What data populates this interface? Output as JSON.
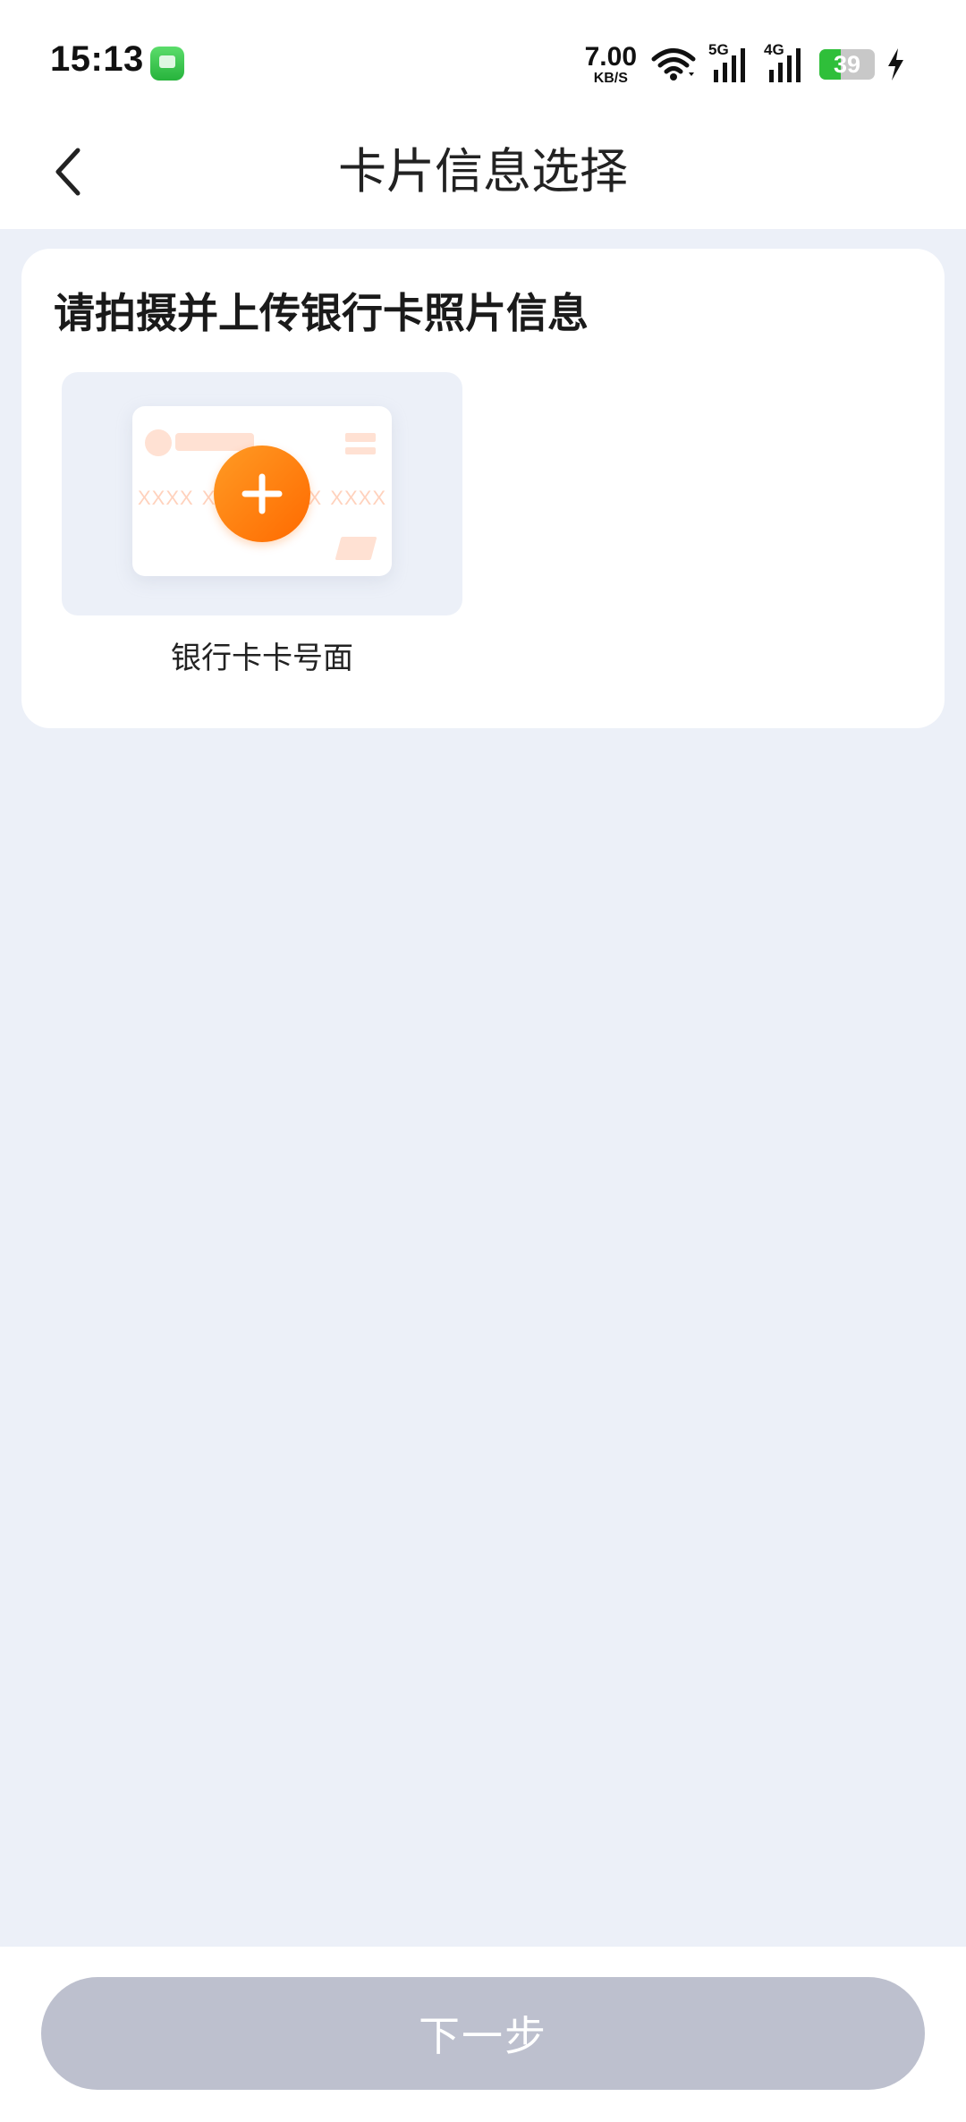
{
  "status_bar": {
    "time": "15:13",
    "net_speed_value": "7.00",
    "net_speed_unit": "KB/S",
    "signal_1_gen": "5G",
    "signal_2_gen": "4G",
    "battery_level": "39",
    "app_icon": "messages-icon"
  },
  "header": {
    "back_icon": "chevron-left-icon",
    "title": "卡片信息选择"
  },
  "upload_card": {
    "title": "请拍摄并上传银行卡照片信息",
    "item": {
      "label": "银行卡卡号面",
      "card_digits": [
        "XXXX",
        "XXXX",
        "XXXX",
        "XXXX"
      ],
      "add_icon": "plus-icon"
    }
  },
  "footer": {
    "next_label": "下一步",
    "next_enabled": false
  },
  "colors": {
    "page_bg": "#ecf0f8",
    "accent_orange": "#ff7a0a",
    "button_disabled": "#bdc0ce"
  }
}
